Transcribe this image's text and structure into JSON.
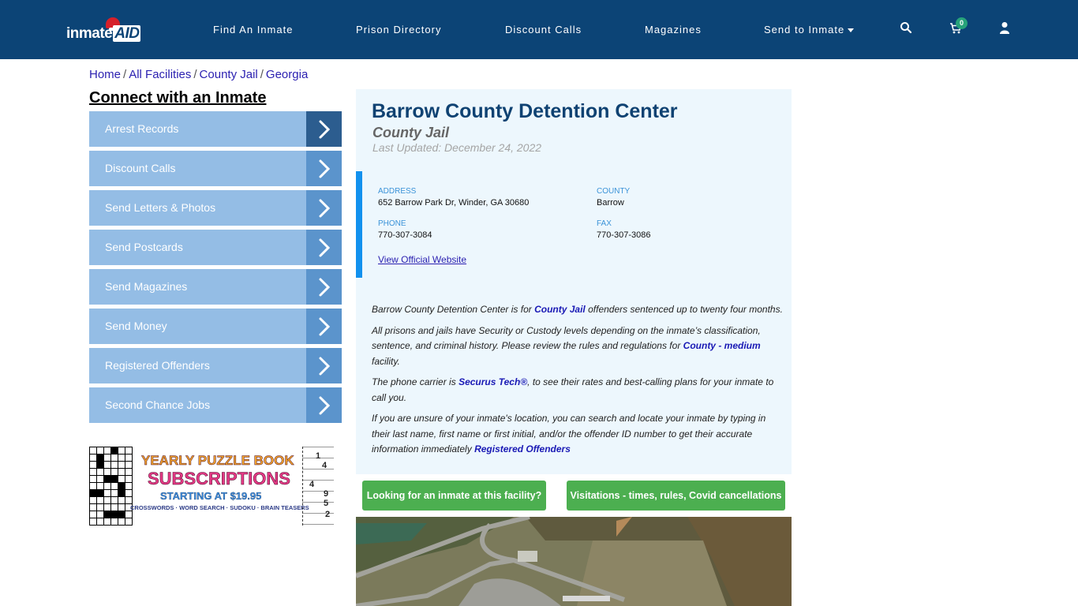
{
  "header": {
    "logo": {
      "text": "inmate",
      "highlight": "AID"
    },
    "nav": [
      {
        "label": "Find An Inmate"
      },
      {
        "label": "Prison Directory"
      },
      {
        "label": "Discount Calls"
      },
      {
        "label": "Magazines"
      },
      {
        "label": "Send to Inmate",
        "has_dropdown": true
      }
    ],
    "icons": {
      "search": "search-icon",
      "cart": "cart-icon",
      "user": "user-icon"
    },
    "cart_count": "0",
    "colors": {
      "nav_bg": "#0c4476",
      "badge": "#27a37a"
    }
  },
  "breadcrumb": [
    {
      "label": "Home"
    },
    {
      "label": "All Facilities"
    },
    {
      "label": "County Jail"
    },
    {
      "label": "Georgia"
    }
  ],
  "breadcrumb_separator": "/",
  "sidebar": {
    "title": "Connect with an Inmate",
    "items": [
      {
        "label": "Arrest Records"
      },
      {
        "label": "Discount Calls"
      },
      {
        "label": "Send Letters & Photos"
      },
      {
        "label": "Send Postcards"
      },
      {
        "label": "Send Magazines"
      },
      {
        "label": "Send Money"
      },
      {
        "label": "Registered Offenders"
      },
      {
        "label": "Second Chance Jobs"
      }
    ],
    "ad": {
      "line1": "YEARLY PUZZLE BOOK",
      "line2": "SUBSCRIPTIONS",
      "line3": "STARTING AT $19.95",
      "line4": "CROSSWORDS · WORD SEARCH · SUDOKU · BRAIN TEASERS",
      "sudoku_digits": [
        "1",
        "4",
        "4",
        "9",
        "5",
        "2"
      ]
    }
  },
  "facility": {
    "name": "Barrow County Detention Center",
    "type": "County Jail",
    "last_updated": "Last Updated: December 24, 2022",
    "address_label": "ADDRESS",
    "address": "652 Barrow Park Dr, Winder, GA 30680",
    "county_label": "COUNTY",
    "county": "Barrow",
    "phone_label": "PHONE",
    "phone": "770-307-3084",
    "fax_label": "FAX",
    "fax": "770-307-3086",
    "website_link": "View Official Website"
  },
  "description": {
    "p1_pre": "Barrow County Detention Center is for ",
    "p1_link": "County Jail",
    "p1_post": " offenders sentenced up to twenty four months.",
    "p2_pre": "All prisons and jails have Security or Custody levels depending on the inmate’s classification, sentence, and criminal history. Please review the rules and regulations for ",
    "p2_link": "County - medium",
    "p2_post": " facility.",
    "p3_pre": "The phone carrier is ",
    "p3_link": "Securus Tech®",
    "p3_post": ", to see their rates and best-calling plans for your inmate to call you.",
    "p4_pre": "If you are unsure of your inmate's location, you can search and locate your inmate by typing in their last name, first name or first initial, and/or the offender ID number to get their accurate information immediately ",
    "p4_link": "Registered Offenders"
  },
  "actions": {
    "find_inmate": "Looking for an inmate at this facility?",
    "visitations": "Visitations - times, rules, Covid cancellations"
  }
}
